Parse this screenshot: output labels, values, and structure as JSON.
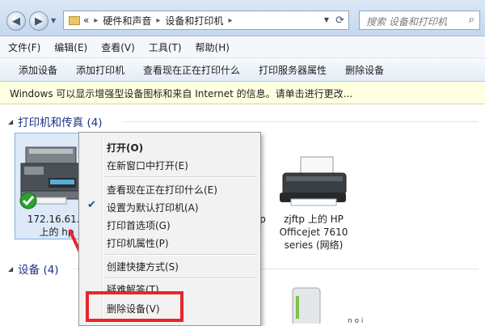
{
  "address_bar": {
    "breadcrumbs": [
      "«",
      "硬件和声音",
      "设备和打印机"
    ],
    "search_placeholder": "搜索 设备和打印机"
  },
  "menu": [
    "文件(F)",
    "编辑(E)",
    "查看(V)",
    "工具(T)",
    "帮助(H)"
  ],
  "toolbar": [
    "添加设备",
    "添加打印机",
    "查看现在正在打印什么",
    "打印服务器属性",
    "删除设备"
  ],
  "info_bar": "Windows 可以显示增强型设备图标和来自 Internet 的信息。请单击进行更改...",
  "groups": {
    "printers": {
      "title": "打印机和传真 (4)"
    },
    "devices": {
      "title": "设备 (4)"
    }
  },
  "devices": {
    "selected_printer": {
      "line1": "172.16.61.1",
      "line2": "上的 hp"
    },
    "hidden_fragment": "p",
    "zjftp_printer": {
      "line1": "zjftp 上的 HP",
      "line2": "Officejet 7610",
      "line3": "series (网络)"
    },
    "bottom_fragment": "n o    i"
  },
  "context_menu": {
    "items": [
      "打开(O)",
      "在新窗口中打开(E)",
      "查看现在正在打印什么(E)",
      "设置为默认打印机(A)",
      "打印首选项(G)",
      "打印机属性(P)",
      "创建快捷方式(S)",
      "疑难解答(T)",
      "删除设备(V)"
    ],
    "checked_item": "设置为默认打印机(A)"
  },
  "colors": {
    "highlight_box": "#e8262a",
    "group_heading": "#1e3287",
    "info_bar_bg": "#ffffe1",
    "selection_bg": "#dce9f8"
  }
}
